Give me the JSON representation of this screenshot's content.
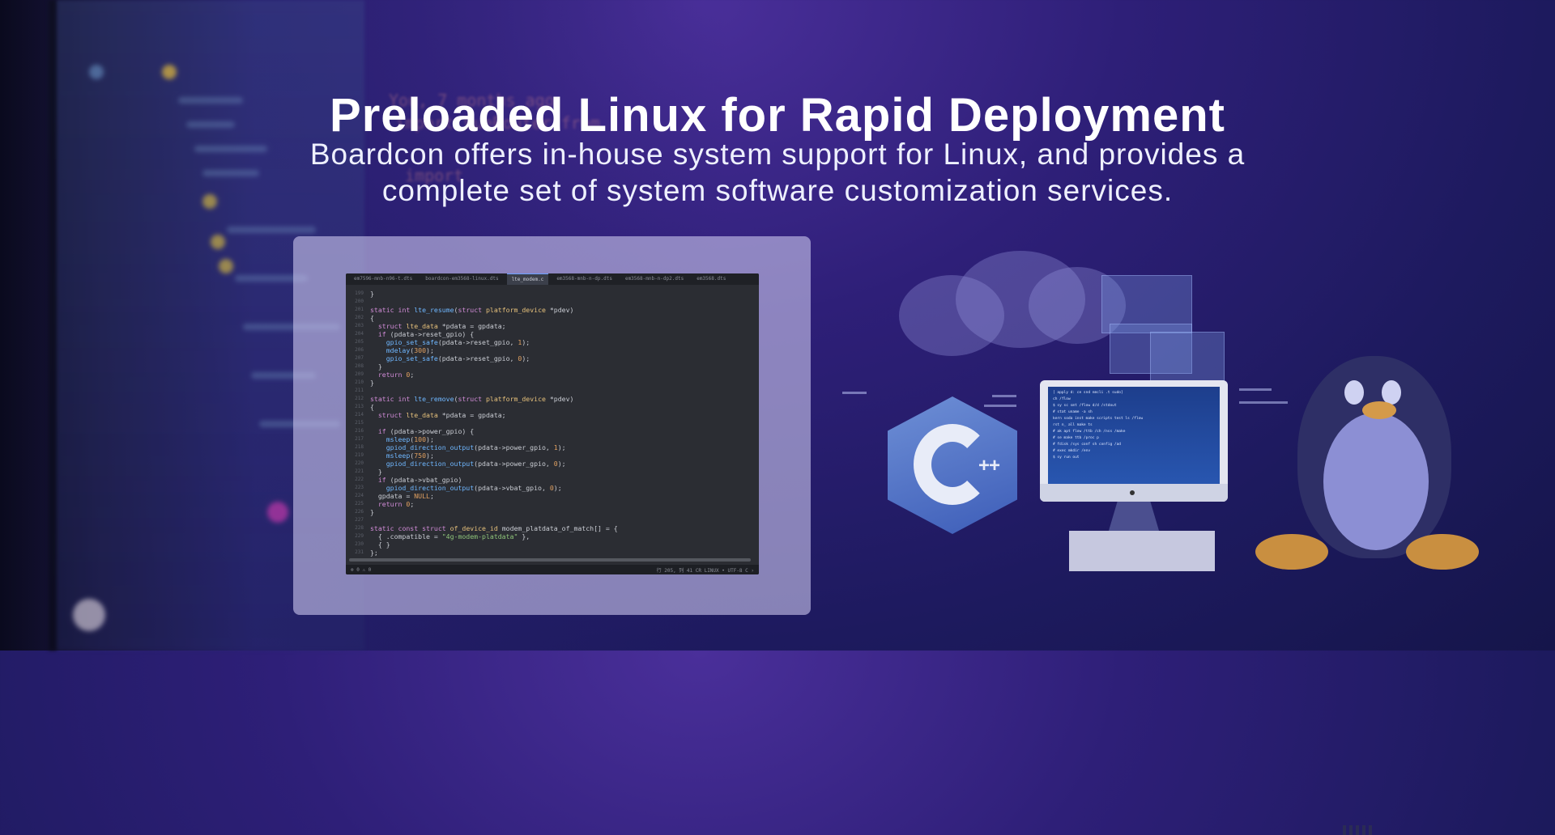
{
  "hero": {
    "title": "Preloaded Linux for Rapid Deployment",
    "subtitle_line1": "Boardcon offers in-house system support for Linux, and provides a",
    "subtitle_line2": "complete set of system software customization services."
  },
  "editor": {
    "tabs": [
      "em7596-mnb-n96-t.dts",
      "boardcon-em3568-linux.dts",
      "lte_modem.c",
      "em3568-mnb-n-dp.dts",
      "em3568-mnb-n-dp2.dts",
      "em3568.dts"
    ],
    "active_tab": "lte_modem.c",
    "code_lines": [
      {
        "n": "199",
        "t": "}"
      },
      {
        "n": "200",
        "t": ""
      },
      {
        "n": "201",
        "t": "static int lte_resume(struct platform_device *pdev)"
      },
      {
        "n": "202",
        "t": "{"
      },
      {
        "n": "203",
        "t": "  struct lte_data *pdata = gpdata;"
      },
      {
        "n": "204",
        "t": "  if (pdata->reset_gpio) {"
      },
      {
        "n": "205",
        "t": "    gpio_set_safe(pdata->reset_gpio, 1);"
      },
      {
        "n": "206",
        "t": "    mdelay(300);"
      },
      {
        "n": "207",
        "t": "    gpio_set_safe(pdata->reset_gpio, 0);"
      },
      {
        "n": "208",
        "t": "  }"
      },
      {
        "n": "209",
        "t": "  return 0;"
      },
      {
        "n": "210",
        "t": "}"
      },
      {
        "n": "211",
        "t": ""
      },
      {
        "n": "212",
        "t": "static int lte_remove(struct platform_device *pdev)"
      },
      {
        "n": "213",
        "t": "{"
      },
      {
        "n": "214",
        "t": "  struct lte_data *pdata = gpdata;"
      },
      {
        "n": "215",
        "t": ""
      },
      {
        "n": "216",
        "t": "  if (pdata->power_gpio) {"
      },
      {
        "n": "217",
        "t": "    msleep(100);"
      },
      {
        "n": "218",
        "t": "    gpiod_direction_output(pdata->power_gpio, 1);"
      },
      {
        "n": "219",
        "t": "    msleep(750);"
      },
      {
        "n": "220",
        "t": "    gpiod_direction_output(pdata->power_gpio, 0);"
      },
      {
        "n": "221",
        "t": "  }"
      },
      {
        "n": "222",
        "t": "  if (pdata->vbat_gpio)"
      },
      {
        "n": "223",
        "t": "    gpiod_direction_output(pdata->vbat_gpio, 0);"
      },
      {
        "n": "224",
        "t": "  gpdata = NULL;"
      },
      {
        "n": "225",
        "t": "  return 0;"
      },
      {
        "n": "226",
        "t": "}"
      },
      {
        "n": "227",
        "t": ""
      },
      {
        "n": "228",
        "t": "static const struct of_device_id modem_platdata_of_match[] = {"
      },
      {
        "n": "229",
        "t": "  { .compatible = \"4g-modem-platdata\" },"
      },
      {
        "n": "230",
        "t": "  { }"
      },
      {
        "n": "231",
        "t": "};"
      }
    ],
    "status_left": "⊗ 0 ⚠ 0",
    "status_right": "行 205, 列 41  CR  LINUX  •  UTF-8  C  ›"
  },
  "screen_text": [
    "[ apply  d:  ce  snd  nmcli  .t  sudo]",
    "  ch  /flow",
    "  $  sy  sc  smt   /flow   d/d  /stdout",
    "  # stat  uname  -a   sh",
    "  kern  soda  inst  make  scripts  test  ls  /flow",
    "  rst  n_  all  make  ts",
    "  #  ak  apt  flow  /ttb  /ch  /nss  /make",
    "  #  se   make  ttb  /proc  p",
    "  #  fdisk  /sys  conf  sh  config  /ad",
    "  #  exec  mkdir  /env",
    "  $  sy   run  out"
  ],
  "colors": {
    "background": "#2e1f78",
    "card": "#c8c3eb",
    "editor_bg": "#2b2d33",
    "keyword": "#d08bd6",
    "function": "#6fb7ff",
    "number": "#e0a060",
    "string": "#8ec479"
  },
  "icons": [
    "cplusplus-logo-icon",
    "monitor-icon",
    "linux-tux-penguin-icon",
    "cloud-icon"
  ]
}
